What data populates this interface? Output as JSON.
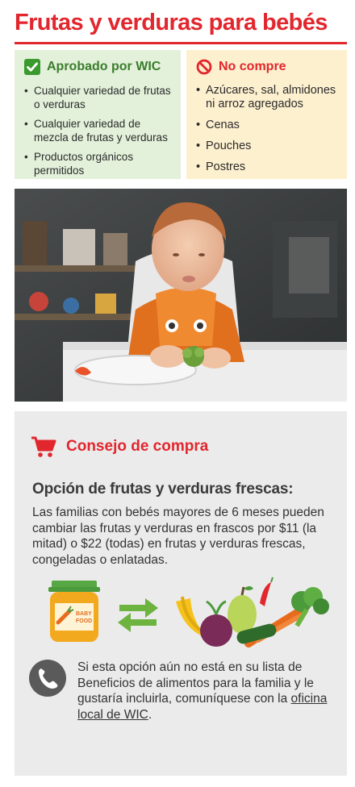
{
  "title": "Frutas y verduras para bebés",
  "approved": {
    "heading": "Aprobado por WIC",
    "items": [
      "Cualquier variedad de frutas o verduras",
      "Cualquier variedad de mezcla de frutas y verduras",
      "Productos orgánicos permitidos"
    ],
    "icon": "checkmark-icon",
    "color": "#3a7d2c"
  },
  "nobuy": {
    "heading": "No compre",
    "items": [
      "Azúcares, sal, almidones ni arroz agregados",
      "Cenas",
      "Pouches",
      "Postres"
    ],
    "icon": "prohibited-icon",
    "color": "#e2262d"
  },
  "tip": {
    "heading": "Consejo de compra",
    "subtitle": "Opción de frutas y verduras frescas:",
    "body": "Las familias con bebés mayores de 6 meses pueden cambiar las frutas y verduras en frascos por $11 (la mitad) o $22 (todas) en frutas y verduras frescas, congeladas o enlatadas.",
    "jar_label_line1": "BABY",
    "jar_label_line2": "FOOD",
    "contact_text": "Si esta opción aún no está en su lista de Beneficios de alimentos para la familia y le gustaría incluirla, comuníquese con la ",
    "contact_link": "oficina local de WIC",
    "contact_end": "."
  },
  "colors": {
    "brand_red": "#e2262d",
    "approved_bg": "#e3f1da",
    "nobuy_bg": "#fdf0cf",
    "tip_bg": "#ebebeb"
  }
}
